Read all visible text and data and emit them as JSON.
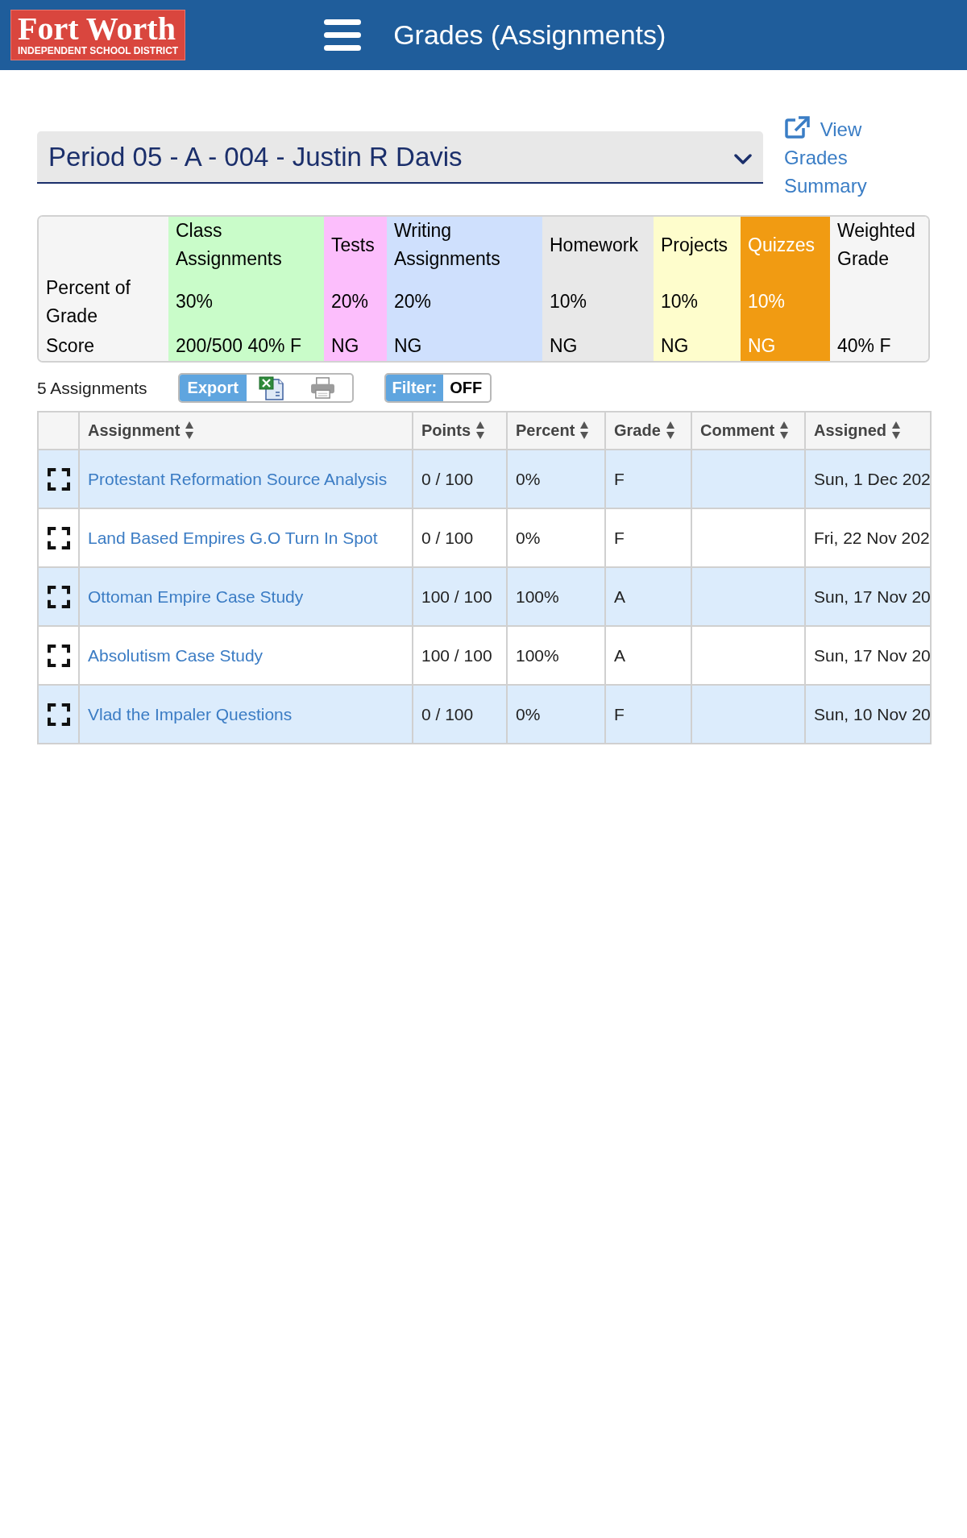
{
  "header": {
    "logo": {
      "wordmark": "Fort Worth",
      "subtitle": "INDEPENDENT SCHOOL DISTRICT"
    },
    "title": "Grades (Assignments)"
  },
  "class_select": {
    "value": "Period 05 - A - 004 - Justin R Davis"
  },
  "summary_link": {
    "label": "View Grades Summary"
  },
  "grade_breakdown": {
    "row_labels": [
      "Percent of Grade",
      "Score"
    ],
    "categories": [
      {
        "name": "Class Assignments",
        "percent": "30%",
        "score": "200/500 40% F",
        "color": "#c9fcc9"
      },
      {
        "name": "Tests",
        "percent": "20%",
        "score": "NG",
        "color": "#fcbefc"
      },
      {
        "name": "Writing Assignments",
        "percent": "20%",
        "score": "NG",
        "color": "#cfe0fd"
      },
      {
        "name": "Homework",
        "percent": "10%",
        "score": "NG",
        "color": "#e8e8e8"
      },
      {
        "name": "Projects",
        "percent": "10%",
        "score": "NG",
        "color": "#fefdcc"
      },
      {
        "name": "Quizzes",
        "percent": "10%",
        "score": "NG",
        "color": "#f19b12"
      }
    ],
    "weighted": {
      "name": "Weighted Grade",
      "score": "40% F"
    }
  },
  "toolbar": {
    "count": "5 Assignments",
    "export": {
      "label": "Export"
    },
    "filter": {
      "label": "Filter:",
      "value": "OFF"
    }
  },
  "assignments": {
    "columns": [
      "Assignment",
      "Points",
      "Percent",
      "Grade",
      "Comment",
      "Assigned"
    ],
    "rows": [
      {
        "assignment": "Protestant Reformation Source Analysis",
        "points": "0 / 100",
        "percent": "0%",
        "grade": "F",
        "assigned": "Sun, 1 Dec 202"
      },
      {
        "assignment": "Land Based Empires G.O Turn In Spot",
        "points": "0 / 100",
        "percent": "0%",
        "grade": "F",
        "assigned": "Fri, 22 Nov 202"
      },
      {
        "assignment": "Ottoman Empire Case Study",
        "points": "100 / 100",
        "percent": "100%",
        "grade": "A",
        "assigned": "Sun, 17 Nov 20"
      },
      {
        "assignment": "Absolutism Case Study",
        "points": "100 / 100",
        "percent": "100%",
        "grade": "A",
        "assigned": "Sun, 17 Nov 20"
      },
      {
        "assignment": "Vlad the Impaler Questions",
        "points": "0 / 100",
        "percent": "0%",
        "grade": "F",
        "assigned": "Sun, 10 Nov 20"
      }
    ]
  }
}
